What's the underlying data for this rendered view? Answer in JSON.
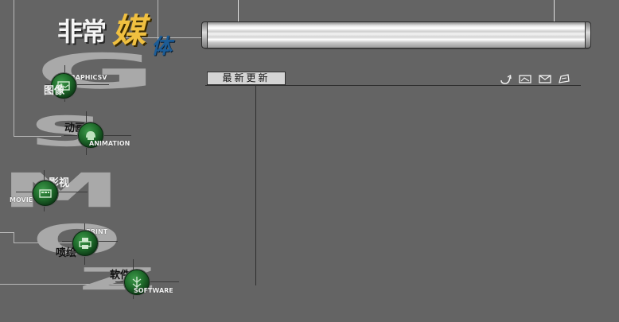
{
  "logo": {
    "part1": "非常",
    "part2": "媒",
    "part3": "体"
  },
  "nav": [
    {
      "cn": "图像",
      "en": "GRAPHICSV",
      "ghost": "G"
    },
    {
      "cn": "动画",
      "en": "ANIMATION",
      "ghost": "S"
    },
    {
      "cn": "影视",
      "en": "MOVIE",
      "ghost": "M"
    },
    {
      "cn": "喷绘",
      "en": "PRINT",
      "ghost": "O"
    },
    {
      "cn": "软件",
      "en": "SOFTWARE",
      "ghost": "Z"
    }
  ],
  "tab": {
    "label": "最新更新"
  },
  "toolbar": {
    "icons": [
      "return-icon",
      "image-icon",
      "mail-icon",
      "note-icon"
    ]
  },
  "colors": {
    "background": "#646464",
    "accent_logo": "#f0c040",
    "logo_blue": "#1c5c96"
  }
}
